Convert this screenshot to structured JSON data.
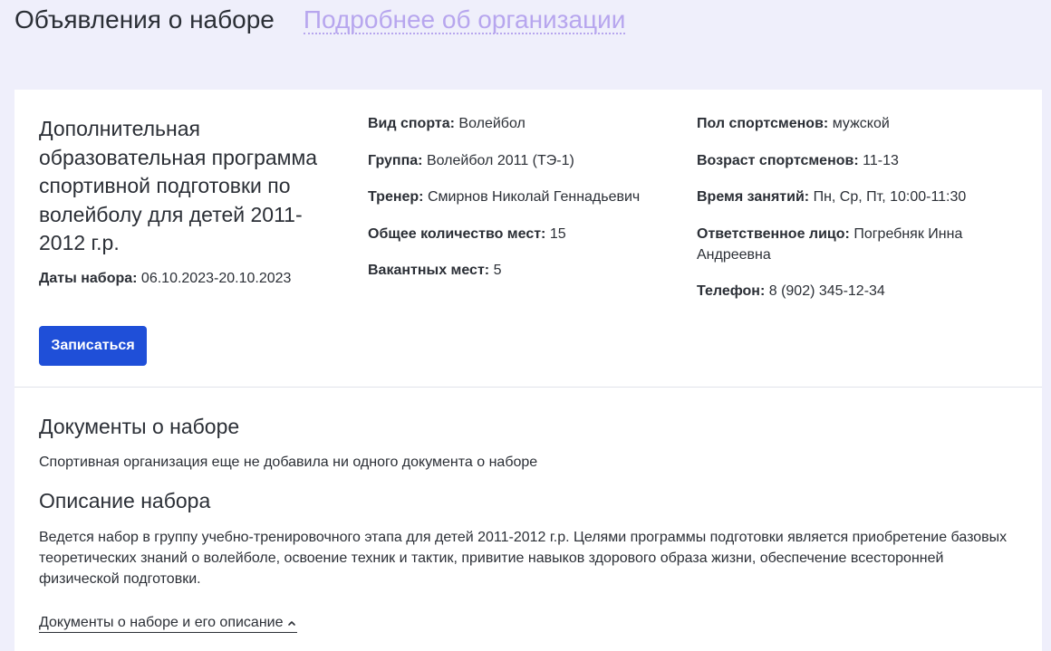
{
  "header": {
    "title": "Объявления о наборе",
    "org_link": "Подробнее об организации"
  },
  "program": {
    "title": "Дополнительная образовательная программа спортивной подготовки по волейболу для детей 2011-2012 г.р.",
    "dates": {
      "label": "Даты набора:",
      "value": "06.10.2023-20.10.2023"
    },
    "apply_label": "Записаться"
  },
  "details_middle": [
    {
      "label": "Вид спорта:",
      "value": "Волейбол"
    },
    {
      "label": "Группа:",
      "value": "Волейбол 2011 (ТЭ-1)"
    },
    {
      "label": "Тренер:",
      "value": "Смирнов Николай Геннадьевич"
    },
    {
      "label": "Общее количество мест:",
      "value": "15"
    },
    {
      "label": "Вакантных мест:",
      "value": "5"
    }
  ],
  "details_right": [
    {
      "label": "Пол спортсменов:",
      "value": "мужской"
    },
    {
      "label": "Возраст спортсменов:",
      "value": "11-13"
    },
    {
      "label": "Время занятий:",
      "value": "Пн, Ср, Пт, 10:00-11:30"
    },
    {
      "label": "Ответственное лицо:",
      "value": "Погребняк Инна Андреевна"
    },
    {
      "label": "Телефон:",
      "value": "8 (902) 345-12-34"
    }
  ],
  "documents": {
    "heading": "Документы о наборе",
    "text": "Спортивная организация еще не добавила ни одного документа о наборе"
  },
  "description": {
    "heading": "Описание набора",
    "text": "Ведется набор в группу учебно-тренировочного этапа для детей 2011-2012 г.р. Целями программы подготовки является приобретение базовых теоретических знаний о волейболе, освоение техник и тактик, привитие навыков здорового образа жизни, обеспечение всесторонней физической подготовки."
  },
  "toggle": {
    "label": "Документы о наборе и его описание",
    "icon": "chevron-up-icon"
  },
  "colors": {
    "background": "#efeffb",
    "accent": "#1f4fd8",
    "link": "#b7a6ee"
  }
}
